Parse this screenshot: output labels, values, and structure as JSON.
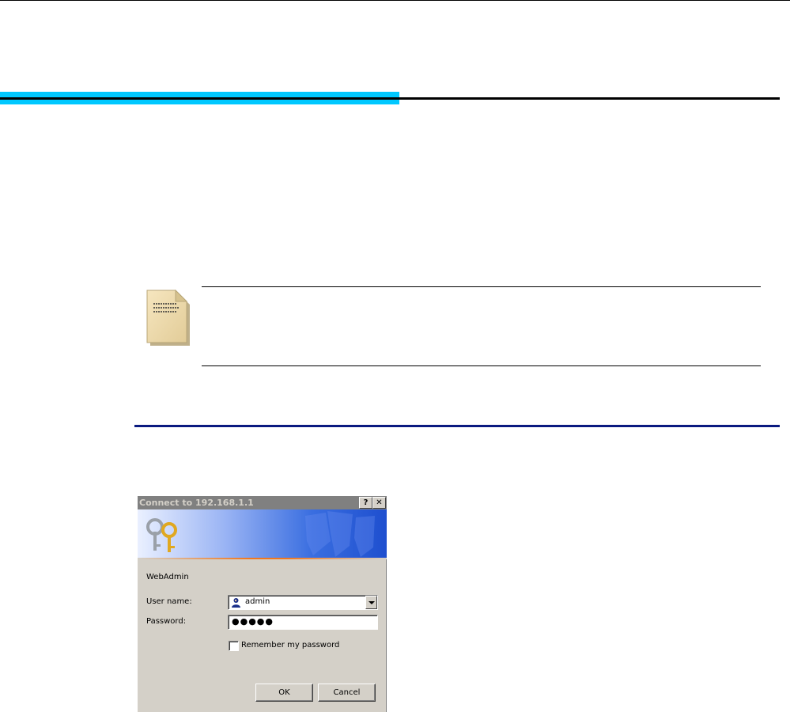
{
  "dialog": {
    "title": "Connect to 192.168.1.1",
    "help_glyph": "?",
    "close_glyph": "✕",
    "caption": "WebAdmin",
    "username_label": "User name:",
    "username_value": "admin",
    "password_label": "Password:",
    "password_value": "●●●●●",
    "remember_label": "Remember my password",
    "remember_checked": false,
    "ok_label": "OK",
    "cancel_label": "Cancel",
    "icons": {
      "banner": "keys-icon",
      "username": "user-icon",
      "dropdown": "chevron-down-icon"
    }
  },
  "document": {
    "icons": {
      "note": "note-page-icon"
    },
    "colors": {
      "heading_accent": "#00c8ff",
      "section_rule": "#0a1a80",
      "banner_accent": "#f07820"
    }
  }
}
